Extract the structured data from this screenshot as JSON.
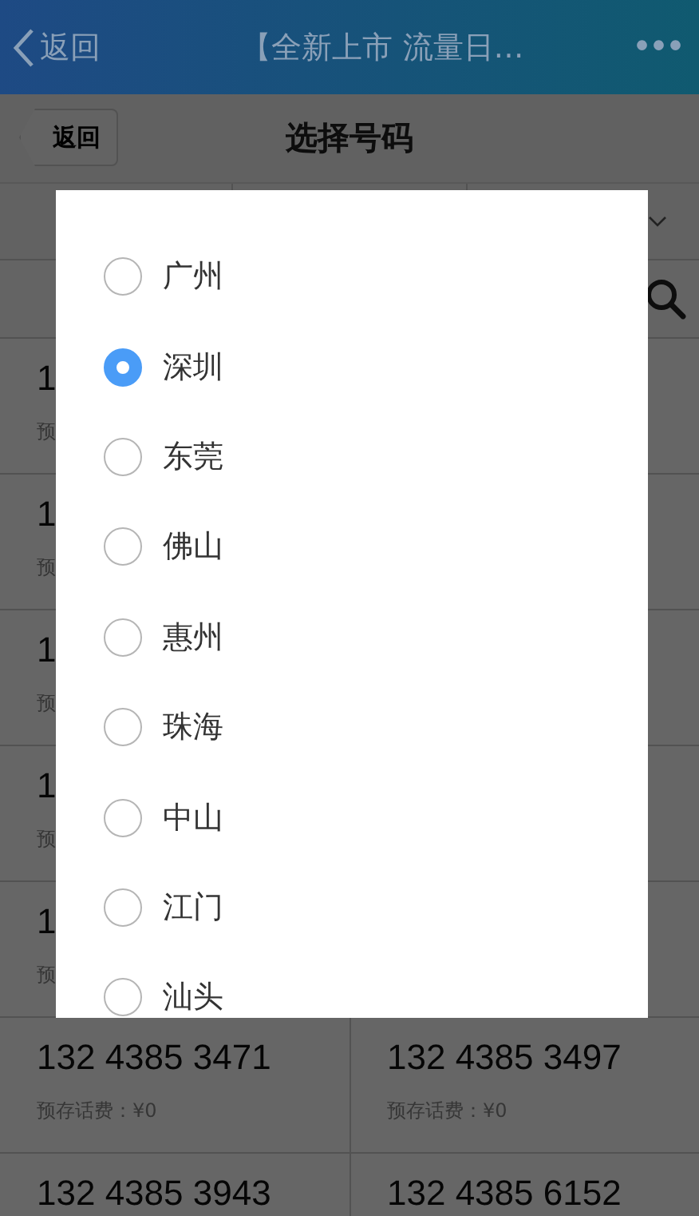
{
  "top_bar": {
    "back": "返回",
    "title": "【全新上市 流量日…",
    "more": "•••"
  },
  "header": {
    "back": "返回",
    "title": "选择号码"
  },
  "number_rows": [
    {
      "cells": [
        {
          "number": "1",
          "deposit": "预"
        }
      ]
    },
    {
      "cells": [
        {
          "number": "1",
          "deposit": "预"
        }
      ]
    },
    {
      "cells": [
        {
          "number": "1",
          "deposit": "预"
        }
      ]
    },
    {
      "cells": [
        {
          "number": "1",
          "deposit": "预"
        }
      ]
    },
    {
      "cells": [
        {
          "number": "1",
          "deposit": "预"
        }
      ]
    },
    {
      "cells": [
        {
          "number": "132 4385 3471",
          "deposit": "预存话费：¥0"
        },
        {
          "number": "132 4385 3497",
          "deposit": "预存话费：¥0"
        }
      ]
    },
    {
      "cells": [
        {
          "number": "132 4385 3943"
        },
        {
          "number": "132 4385 6152"
        }
      ]
    }
  ],
  "dialog": {
    "options": [
      {
        "label": "广州",
        "selected": false
      },
      {
        "label": "深圳",
        "selected": true
      },
      {
        "label": "东莞",
        "selected": false
      },
      {
        "label": "佛山",
        "selected": false
      },
      {
        "label": "惠州",
        "selected": false
      },
      {
        "label": "珠海",
        "selected": false
      },
      {
        "label": "中山",
        "selected": false
      },
      {
        "label": "江门",
        "selected": false
      },
      {
        "label": "汕头",
        "selected": false
      }
    ]
  }
}
